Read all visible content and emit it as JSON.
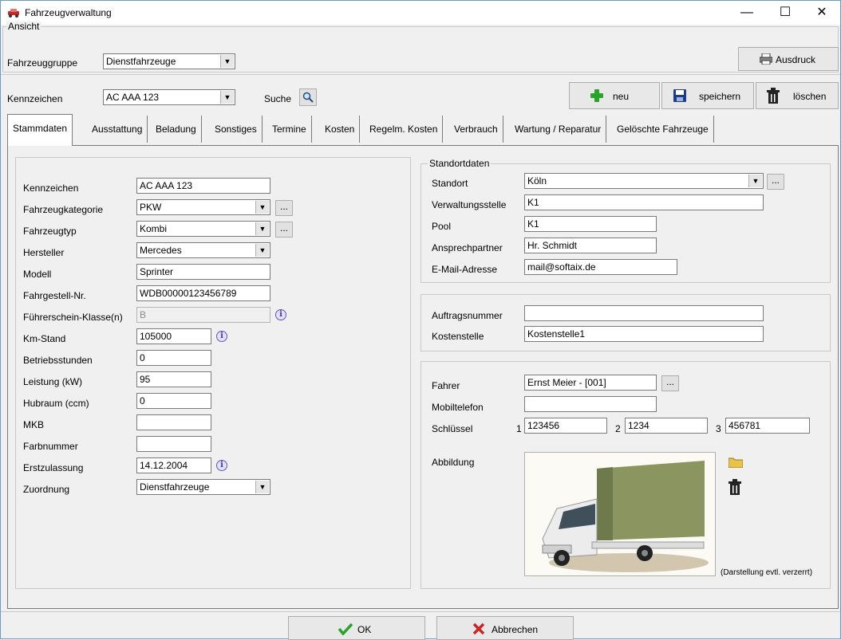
{
  "window": {
    "title": "Fahrzeugverwaltung",
    "controls": {
      "minimize": "—",
      "maximize": "☐",
      "close": "✕"
    }
  },
  "ansicht": {
    "legend": "Ansicht",
    "label": "Fahrzeuggruppe",
    "value": "Dienstfahrzeuge",
    "print_label": "Ausdruck"
  },
  "toolbar": {
    "kennzeichen_label": "Kennzeichen",
    "kennzeichen_value": "AC AAA 123",
    "suche_label": "Suche",
    "new_label": "neu",
    "save_label": "speichern",
    "delete_label": "löschen"
  },
  "tabs": [
    {
      "label": "Stammdaten",
      "active": true
    },
    {
      "label": "Ausstattung"
    },
    {
      "label": "Beladung"
    },
    {
      "label": "Sonstiges"
    },
    {
      "label": "Termine"
    },
    {
      "label": "Kosten"
    },
    {
      "label": "Regelm. Kosten"
    },
    {
      "label": "Verbrauch"
    },
    {
      "label": "Wartung / Reparatur"
    },
    {
      "label": "Gelöschte Fahrzeuge"
    }
  ],
  "stammdaten": {
    "kennzeichen": {
      "label": "Kennzeichen",
      "value": "AC AAA 123"
    },
    "fahrzeugkategorie": {
      "label": "Fahrzeugkategorie",
      "value": "PKW"
    },
    "fahrzeugtyp": {
      "label": "Fahrzeugtyp",
      "value": "Kombi"
    },
    "hersteller": {
      "label": "Hersteller",
      "value": "Mercedes"
    },
    "modell": {
      "label": "Modell",
      "value": "Sprinter"
    },
    "fahrgestell": {
      "label": "Fahrgestell-Nr.",
      "value": "WDB00000123456789"
    },
    "fuehrerschein": {
      "label": "Führerschein-Klasse(n)",
      "value": "B"
    },
    "kmstand": {
      "label": "Km-Stand",
      "value": "105000"
    },
    "betriebsstunden": {
      "label": "Betriebsstunden",
      "value": "0"
    },
    "leistung": {
      "label": "Leistung (kW)",
      "value": "95"
    },
    "hubraum": {
      "label": "Hubraum (ccm)",
      "value": "0"
    },
    "mkb": {
      "label": "MKB",
      "value": ""
    },
    "farbnummer": {
      "label": "Farbnummer",
      "value": ""
    },
    "erstzulassung": {
      "label": "Erstzulassung",
      "value": "14.12.2004"
    },
    "zuordnung": {
      "label": "Zuordnung",
      "value": "Dienstfahrzeuge"
    }
  },
  "standortdaten": {
    "legend": "Standortdaten",
    "standort": {
      "label": "Standort",
      "value": "Köln"
    },
    "verwaltungsstelle": {
      "label": "Verwaltungsstelle",
      "value": "K1"
    },
    "pool": {
      "label": "Pool",
      "value": "K1"
    },
    "ansprechpartner": {
      "label": "Ansprechpartner",
      "value": "Hr. Schmidt"
    },
    "email": {
      "label": "E-Mail-Adresse",
      "value": "mail@softaix.de"
    }
  },
  "auftrag": {
    "auftragsnummer": {
      "label": "Auftragsnummer",
      "value": ""
    },
    "kostenstelle": {
      "label": "Kostenstelle",
      "value": "Kostenstelle1"
    }
  },
  "fahrer": {
    "fahrer": {
      "label": "Fahrer",
      "value": "Ernst Meier - [001]"
    },
    "mobiltelefon": {
      "label": "Mobiltelefon",
      "value": ""
    },
    "schluessel": {
      "label": "Schlüssel",
      "n1": "1",
      "v1": "123456",
      "n2": "2",
      "v2": "1234",
      "n3": "3",
      "v3": "456781"
    },
    "abbildung": {
      "label": "Abbildung",
      "note": "(Darstellung evtl. verzerrt)"
    }
  },
  "dialog": {
    "ok_label": "OK",
    "cancel_label": "Abbrechen"
  },
  "colors": {
    "info_icon": "#3a3aa8",
    "green_plus": "#2aa32a",
    "ok_check": "#2aa32a",
    "cancel_x": "#c62828",
    "save_icon": "#1f3e8a",
    "window_border": "#6d9ac5"
  },
  "icons": {
    "app": "car-icon",
    "print": "printer-icon",
    "search": "magnifier-icon",
    "new": "green-plus-icon",
    "save": "floppy-disk-icon",
    "delete": "trash-icon",
    "info": "info-icon",
    "folder": "folder-icon",
    "trash_small": "trash-icon",
    "ok": "check-icon",
    "cancel": "x-icon"
  }
}
